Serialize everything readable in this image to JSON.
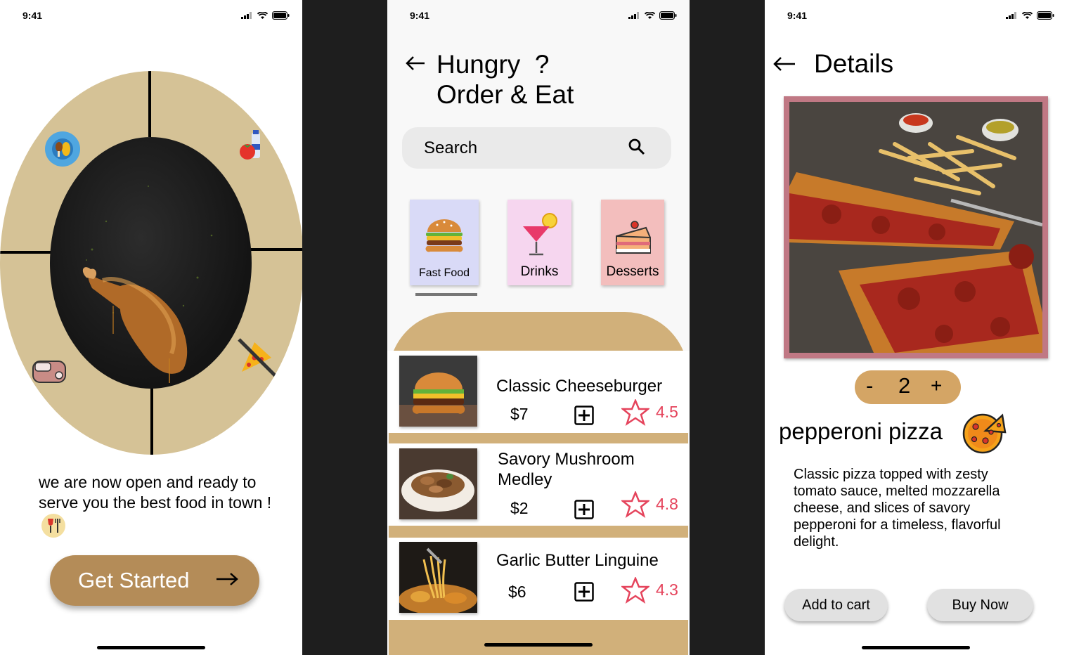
{
  "status_bar": {
    "time": "9:41"
  },
  "onboarding": {
    "tagline": "we are now open and ready to serve you the best food in town !",
    "cta_label": "Get Started"
  },
  "menu": {
    "title_line1": "Hungry  ?",
    "title_line2": "Order & Eat",
    "search_placeholder": "Search",
    "categories": [
      {
        "label": "Fast Food",
        "color": "#d9daf7",
        "icon": "burger-icon",
        "selected": true
      },
      {
        "label": "Drinks",
        "color": "#f6d6ef",
        "icon": "cocktail-icon",
        "selected": false
      },
      {
        "label": "Desserts",
        "color": "#f3bebd",
        "icon": "cake-icon",
        "selected": false
      }
    ],
    "items": [
      {
        "name": "Classic Cheeseburger",
        "price": "$7",
        "rating": "4.5",
        "image": "cheeseburger-photo"
      },
      {
        "name": "Savory Mushroom Medley",
        "price": "$2",
        "rating": "4.8",
        "image": "mushroom-photo"
      },
      {
        "name": "Garlic Butter Linguine",
        "price": "$6",
        "rating": "4.3",
        "image": "linguine-photo"
      }
    ]
  },
  "details": {
    "title": "Details",
    "quantity": "2",
    "qty_minus": "-",
    "qty_plus": "+",
    "product_name": "pepperoni pizza",
    "description": "Classic pizza topped with zesty tomato sauce, melted mozzarella cheese, and slices of savory pepperoni for a timeless, flavorful delight.",
    "add_to_cart": "Add to cart",
    "buy_now": "Buy Now"
  },
  "colors": {
    "accent_gold": "#b48c58",
    "oval_beige": "#d5c296",
    "menu_tan": "#d1b07a",
    "rating_red": "#e5445c",
    "frame_rose": "#c07884",
    "qty_orange": "#d4a565"
  }
}
